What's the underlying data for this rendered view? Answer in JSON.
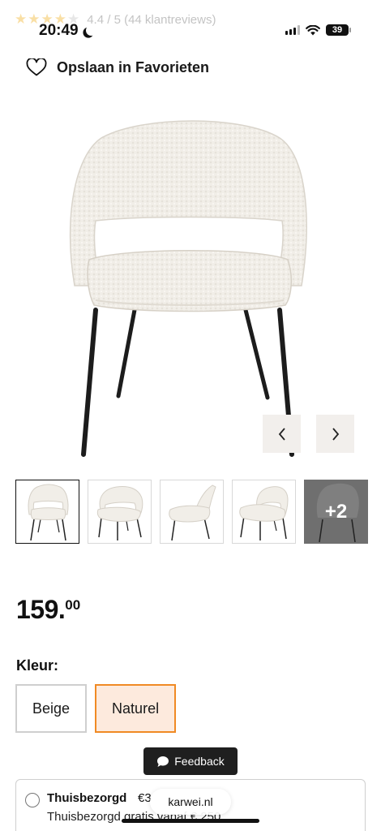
{
  "status_bar": {
    "time": "20:49",
    "battery": "39",
    "rating_overlay": {
      "stars": 4.4,
      "text": "4.4 / 5 (44 klantreviews)"
    }
  },
  "favorite": {
    "label": "Opslaan in Favorieten",
    "icon": "heart-icon"
  },
  "gallery": {
    "prev_icon": "chevron-left-icon",
    "next_icon": "chevron-right-icon",
    "thumbnails": [
      "front",
      "front-angle",
      "side",
      "three-quarter"
    ],
    "more_label": "+2"
  },
  "price": {
    "whole": "159.",
    "cents": "00"
  },
  "color": {
    "label": "Kleur:",
    "options": [
      "Beige",
      "Naturel"
    ],
    "selected": "Naturel",
    "accent": "#f08a24"
  },
  "feedback": {
    "label": "Feedback",
    "icon": "chat-bubble-icon"
  },
  "delivery": {
    "title": "Thuisbezorgd",
    "price_partial": "€3",
    "subtitle_partial": "Thuisbezorgd gratis vanaf € 250"
  },
  "browser": {
    "url": "karwei.nl"
  }
}
